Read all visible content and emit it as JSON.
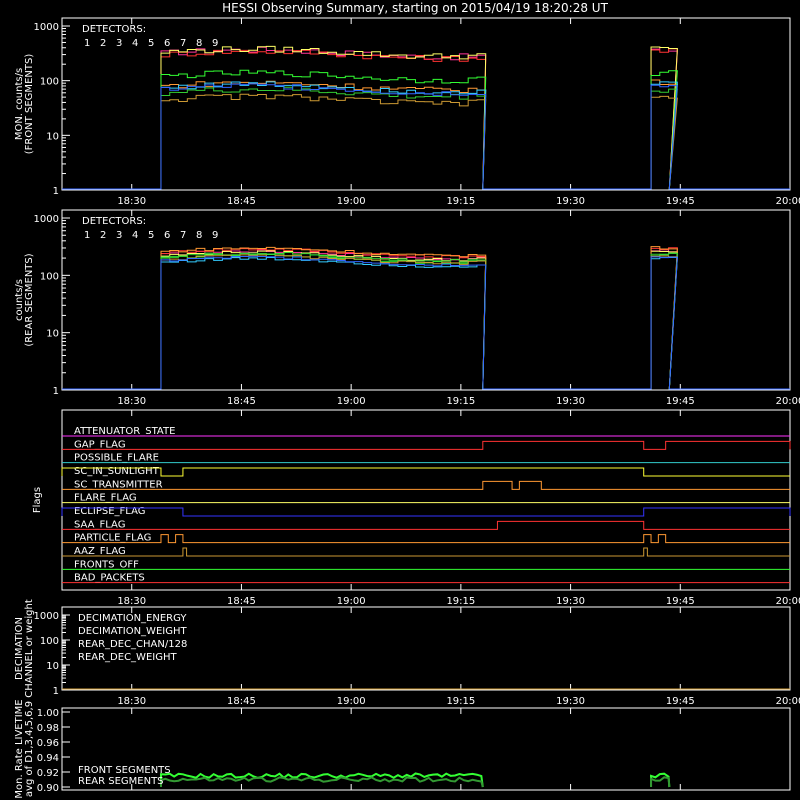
{
  "title": "HESSI Observing Summary, starting on 2015/04/19 18:20:28 UT",
  "time_ticks": [
    "18:30",
    "18:45",
    "19:00",
    "19:15",
    "19:30",
    "19:45",
    "20:00"
  ],
  "chart_data": [
    {
      "id": "front",
      "type": "line",
      "yscale": "log",
      "ylim": [
        1,
        1000
      ],
      "ytick_labels": [
        "1",
        "10",
        "100",
        "1000"
      ],
      "ylabel": [
        "MON. counts/s",
        "(FRONT SEGMENTS)"
      ],
      "legend_title": "DETECTORS:",
      "legend_numbers": [
        "1",
        "2",
        "3",
        "4",
        "5",
        "6",
        "7",
        "8",
        "9"
      ],
      "series": [
        {
          "name": "1",
          "color": "#ff3399",
          "level": 320
        },
        {
          "name": "2",
          "color": "#ff3333",
          "level": 300
        },
        {
          "name": "3",
          "color": "#ffff66",
          "level": 330
        },
        {
          "name": "4",
          "color": "#ff9933",
          "level": 80
        },
        {
          "name": "5",
          "color": "#33ff33",
          "level": 120
        },
        {
          "name": "6",
          "color": "#33cc33",
          "level": 60
        },
        {
          "name": "7",
          "color": "#cc9933",
          "level": 45
        },
        {
          "name": "8",
          "color": "#33ccff",
          "level": 75
        },
        {
          "name": "9",
          "color": "#3366ff",
          "level": 70
        }
      ]
    },
    {
      "id": "rear",
      "type": "line",
      "yscale": "log",
      "ylim": [
        1,
        1000
      ],
      "ytick_labels": [
        "1",
        "10",
        "100",
        "1000"
      ],
      "ylabel": [
        "counts/s",
        "(REAR SEGMENTS)"
      ],
      "legend_title": "DETECTORS:",
      "legend_numbers": [
        "1",
        "2",
        "3",
        "4",
        "5",
        "6",
        "7",
        "8",
        "9"
      ],
      "series": [
        {
          "name": "1",
          "color": "#ff3399",
          "level": 230
        },
        {
          "name": "2",
          "color": "#ff3333",
          "level": 250
        },
        {
          "name": "3",
          "color": "#ffff66",
          "level": 220
        },
        {
          "name": "4",
          "color": "#ff9933",
          "level": 260
        },
        {
          "name": "5",
          "color": "#33ff33",
          "level": 200
        },
        {
          "name": "6",
          "color": "#33cc33",
          "level": 210
        },
        {
          "name": "7",
          "color": "#cc9933",
          "level": 190
        },
        {
          "name": "8",
          "color": "#33ccff",
          "level": 170
        },
        {
          "name": "9",
          "color": "#3366ff",
          "level": 180
        }
      ]
    },
    {
      "id": "flags",
      "type": "line",
      "ylabel": [
        "Flags"
      ],
      "flags": [
        {
          "name": "ATTENUATOR_STATE",
          "color": "#ff33ff",
          "segments": []
        },
        {
          "name": "GAP_FLAG",
          "color": "#ff3333",
          "segments": [
            [
              "19:18",
              "19:40"
            ],
            [
              "19:43",
              "20:00"
            ]
          ]
        },
        {
          "name": "POSSIBLE_FLARE",
          "color": "#33cccc",
          "segments": []
        },
        {
          "name": "SC_IN_SUNLIGHT",
          "color": "#ffff33",
          "segments": [
            [
              "18:20:28",
              "18:34"
            ],
            [
              "18:37",
              "19:40"
            ]
          ]
        },
        {
          "name": "SC_TRANSMITTER",
          "color": "#ff9933",
          "segments": [
            [
              "19:18",
              "19:22"
            ],
            [
              "19:23",
              "19:26"
            ]
          ]
        },
        {
          "name": "FLARE_FLAG",
          "color": "#ffff66",
          "segments": []
        },
        {
          "name": "ECLIPSE_FLAG",
          "color": "#3333ff",
          "segments": [
            [
              "18:20:28",
              "18:37"
            ],
            [
              "19:40",
              "20:00"
            ]
          ]
        },
        {
          "name": "SAA_FLAG",
          "color": "#ff3333",
          "segments": [
            [
              "19:20",
              "19:40"
            ]
          ]
        },
        {
          "name": "PARTICLE_FLAG",
          "color": "#ff9933",
          "segments": [
            [
              "18:34",
              "18:35"
            ],
            [
              "18:36",
              "18:37"
            ],
            [
              "19:40",
              "19:41"
            ],
            [
              "19:42",
              "19:43"
            ]
          ]
        },
        {
          "name": "AAZ_FLAG",
          "color": "#cc9933",
          "segments": [
            [
              "18:37",
              "18:37:30"
            ],
            [
              "19:40",
              "19:40:30"
            ]
          ]
        },
        {
          "name": "FRONTS_OFF",
          "color": "#33ff33",
          "segments": []
        },
        {
          "name": "BAD_PACKETS",
          "color": "#ff3333",
          "segments": []
        }
      ]
    },
    {
      "id": "decimation",
      "type": "line",
      "yscale": "log",
      "ylim": [
        1,
        1000
      ],
      "ytick_labels": [
        "1",
        "10",
        "100",
        "1000"
      ],
      "ylabel": [
        "DECIMATION",
        "CHANNEL or weight"
      ],
      "legend": [
        {
          "name": "DECIMATION_ENERGY",
          "color": "#33ff33"
        },
        {
          "name": "DECIMATION_WEIGHT",
          "color": "#ff6633"
        },
        {
          "name": "REAR_DEC_CHAN/128",
          "color": "#33cccc"
        },
        {
          "name": "REAR_DEC_WEIGHT",
          "color": "#cc9933"
        }
      ]
    },
    {
      "id": "livetime",
      "type": "line",
      "ylim": [
        0.9,
        1.0
      ],
      "ytick_labels": [
        "0.90",
        "0.92",
        "0.94",
        "0.96",
        "0.98",
        "1.00"
      ],
      "ylabel": [
        "Mon. Rate LIVETIME",
        "avg of D1,3,4,5,6,9"
      ],
      "legend": [
        {
          "name": "FRONT SEGMENTS",
          "color": "#33ff33"
        },
        {
          "name": "REAR SEGMENTS",
          "color": "#339933"
        }
      ],
      "series": [
        {
          "name": "FRONT SEGMENTS",
          "color": "#33ff33",
          "level": 0.915
        },
        {
          "name": "REAR SEGMENTS",
          "color": "#339933",
          "level": 0.91
        }
      ]
    }
  ]
}
